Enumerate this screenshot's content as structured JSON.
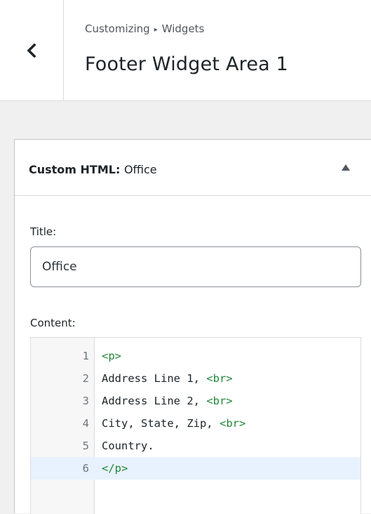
{
  "header": {
    "breadcrumb": {
      "root": "Customizing",
      "separator": "▸",
      "current": "Widgets"
    },
    "title": "Footer Widget Area 1",
    "back_icon": "chevron-left-icon"
  },
  "widget": {
    "type_label": "Custom HTML:",
    "name": "Office",
    "toggle_icon": "triangle-up-icon",
    "title_label": "Title:",
    "title_value": "Office",
    "content_label": "Content:",
    "editor": {
      "lines": [
        {
          "number": "1",
          "text": "",
          "tag": "<p>"
        },
        {
          "number": "2",
          "text": "Address Line 1, ",
          "tag": "<br>"
        },
        {
          "number": "3",
          "text": "Address Line 2, ",
          "tag": "<br>"
        },
        {
          "number": "4",
          "text": "City, State, Zip, ",
          "tag": "<br>"
        },
        {
          "number": "5",
          "text": "Country.",
          "tag": ""
        },
        {
          "number": "6",
          "text": "",
          "tag": "</p>"
        }
      ],
      "active_line": 6
    }
  },
  "colors": {
    "tag": "#22863a",
    "active_line": "#e8f2fe",
    "panel_bg": "#f0f0f1"
  }
}
